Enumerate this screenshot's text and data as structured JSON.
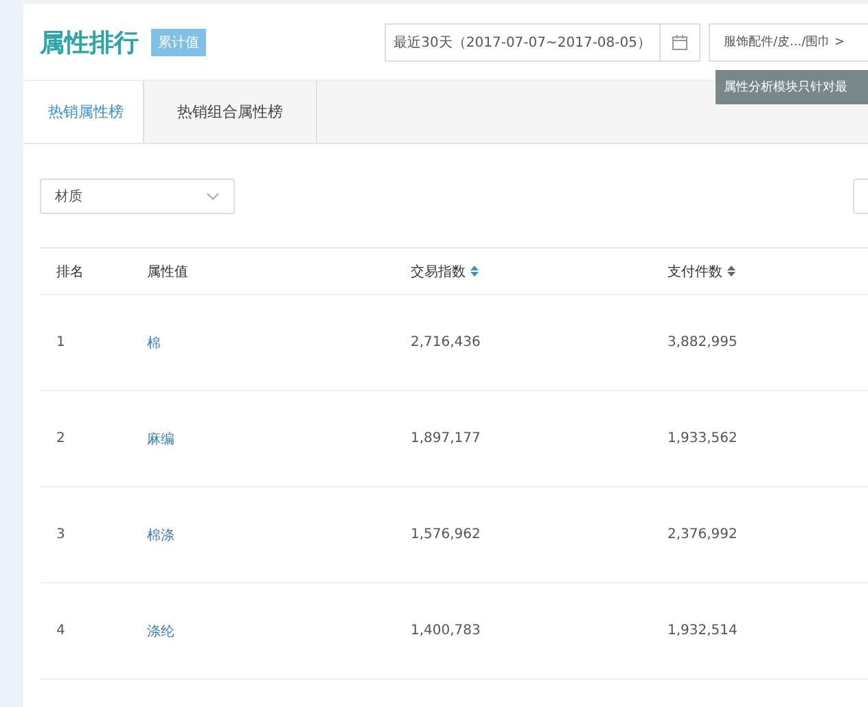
{
  "header": {
    "title": "属性排行",
    "badge": "累计值",
    "date_range": "最近30天（2017-07-07~2017-08-05）",
    "category": "服饰配件/皮.../围巾 >",
    "tooltip": "属性分析模块只针对最"
  },
  "tabs": [
    {
      "label": "热销属性榜",
      "selected": true
    },
    {
      "label": "热销组合属性榜",
      "selected": false
    }
  ],
  "filter": {
    "value": "材质"
  },
  "table": {
    "columns": [
      {
        "label": "排名"
      },
      {
        "label": "属性值"
      },
      {
        "label": "交易指数",
        "sorted": true
      },
      {
        "label": "支付件数",
        "sorted": false
      }
    ],
    "rows": [
      {
        "rank": "1",
        "value": "棉",
        "trade_index": "2,716,436",
        "paid_items": "3,882,995"
      },
      {
        "rank": "2",
        "value": "麻编",
        "trade_index": "1,897,177",
        "paid_items": "1,933,562"
      },
      {
        "rank": "3",
        "value": "棉涤",
        "trade_index": "1,576,962",
        "paid_items": "2,376,992"
      },
      {
        "rank": "4",
        "value": "涤纶",
        "trade_index": "1,400,783",
        "paid_items": "1,932,514"
      }
    ]
  }
}
